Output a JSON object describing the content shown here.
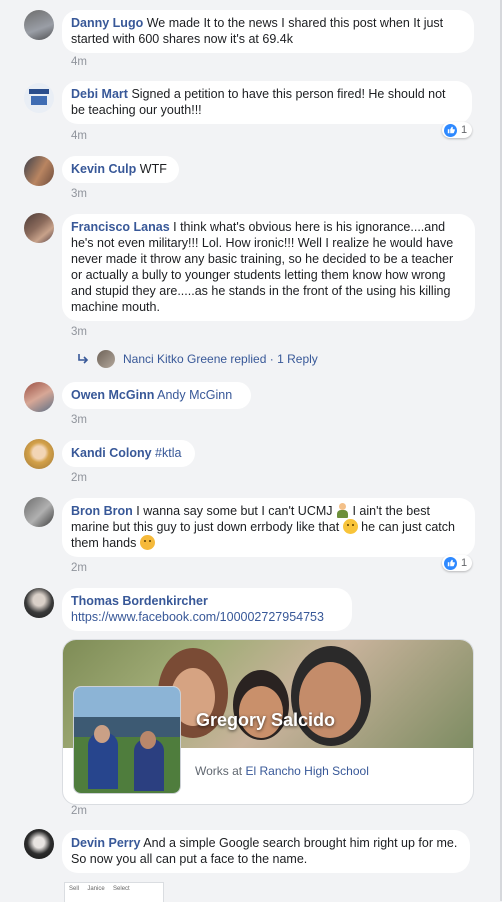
{
  "comments": [
    {
      "author": "Danny Lugo",
      "text": "We made It to the news I shared this post when It just started with 600 shares now it's at 69.4k",
      "time": "4m"
    },
    {
      "author": "Debi Mart",
      "text": "Signed a petition to have this person fired! He should not be teaching our youth!!!",
      "time": "4m",
      "reactions": "1"
    },
    {
      "author": "Kevin Culp",
      "text": "WTF",
      "time": "3m"
    },
    {
      "author": "Francisco Lanas",
      "text": "I think what's obvious here is his ignorance....and he's not even military!!! Lol. How ironic!!! Well I realize he would have never made it throw any basic training, so he decided to be a teacher or actually a bully to younger students letting them know how wrong and stupid they are.....as he stands in the front of the using his killing machine mouth.",
      "time": "3m",
      "reply": {
        "name": "Nanci Kitko Greene replied",
        "dot": " · ",
        "count": "1 Reply"
      }
    },
    {
      "author": "Owen McGinn",
      "tag": "Andy McGinn",
      "time": "3m"
    },
    {
      "author": "Kandi Colony",
      "tag": "#ktla",
      "time": "2m"
    },
    {
      "author": "Bron Bron",
      "text_parts": [
        "I wanna say some but I can't UCMJ ",
        "I ain't the best marine but this guy to just down errbody like that ",
        "he can just catch them hands "
      ],
      "time": "2m",
      "reactions": "1"
    },
    {
      "author": "Thomas Bordenkircher",
      "link": "https://www.facebook.com/100002727954753",
      "time": "2m",
      "card": {
        "name": "Gregory Salcido",
        "sub_prefix": "Works at ",
        "sub_place": "El Rancho High School"
      }
    },
    {
      "author": "Devin Perry",
      "text": "And a simple Google search brought him right up for me. So now you all can put a face to the name."
    }
  ],
  "partial_image_text": "Sell     Janice     Select",
  "colors": {
    "author": "#385898",
    "like": "#2e89ff",
    "bubble": "#ffffff",
    "background": "#f2f3f5"
  },
  "icons": [
    "like-thumb-icon",
    "reply-arrow-icon",
    "smile-emoji-icon",
    "soldier-emoji-icon",
    "dizzy-emoji-icon"
  ]
}
